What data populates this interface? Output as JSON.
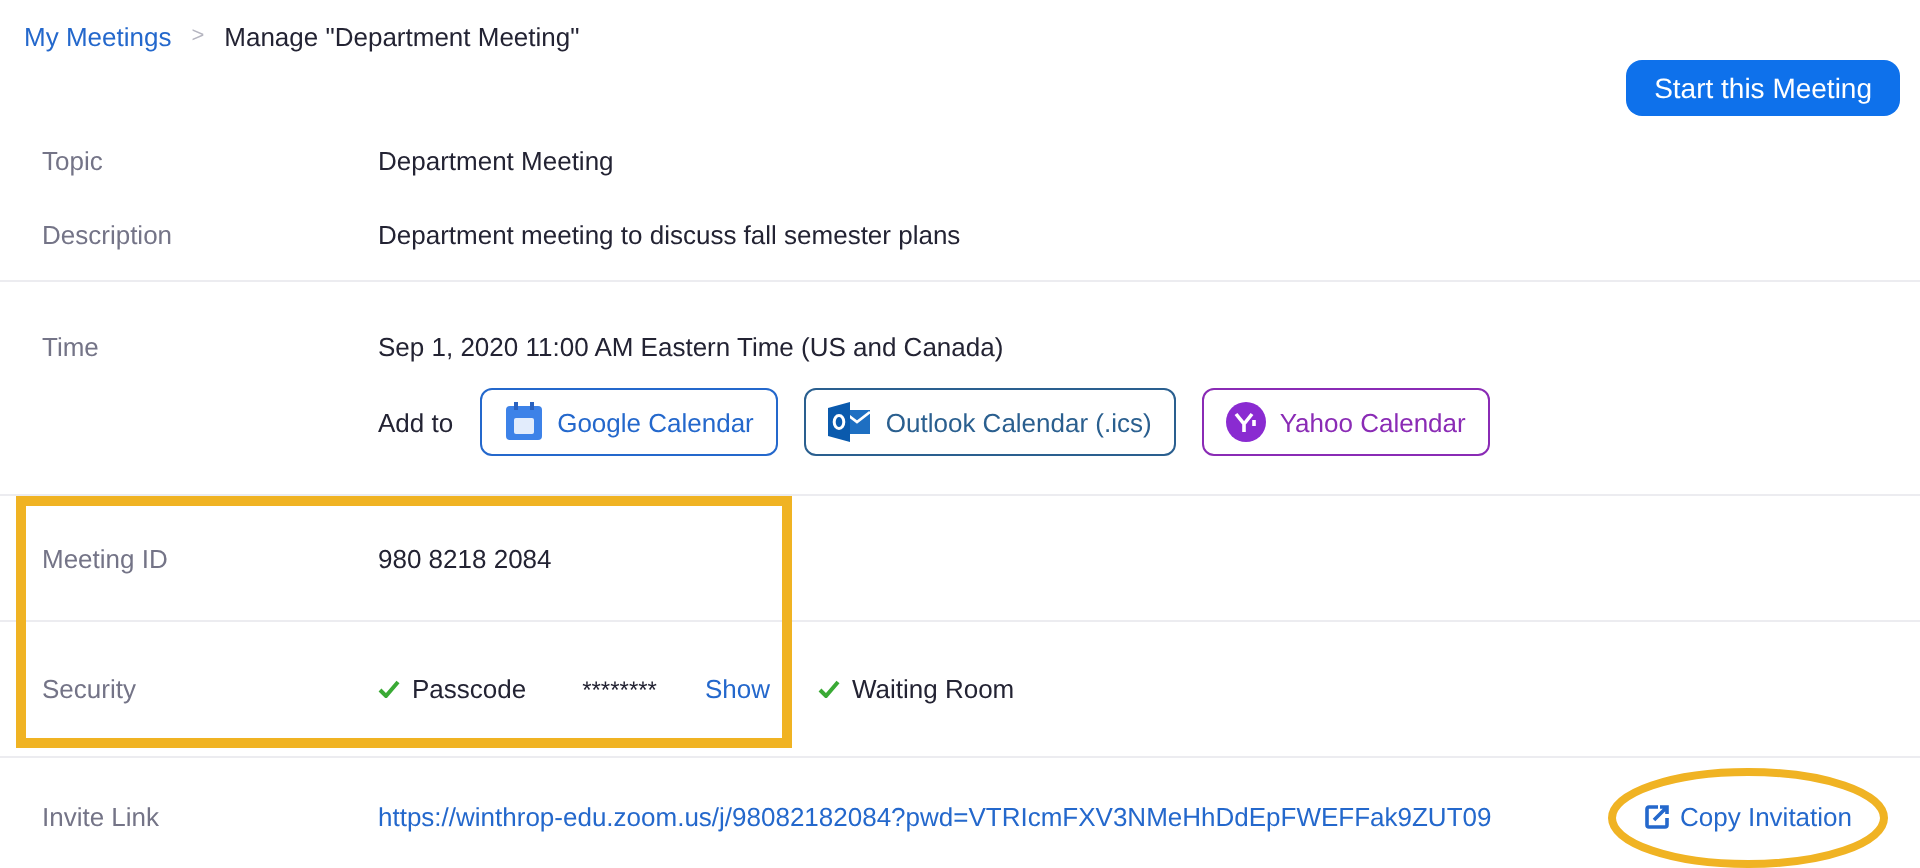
{
  "breadcrumb": [
    {
      "label": "My Meetings",
      "kind": "link"
    },
    {
      "label": "Manage \"Department Meeting\"",
      "kind": "current"
    }
  ],
  "breadcrumb_separator": ">",
  "start_button": "Start this Meeting",
  "sections": [
    {
      "rows": [
        {
          "kind": "text",
          "label": "Topic",
          "value": "Department Meeting"
        },
        {
          "kind": "text",
          "label": "Description",
          "value": "Department meeting to discuss fall semester plans"
        }
      ]
    },
    {
      "rows": [
        {
          "kind": "text",
          "label": "Time",
          "value": "Sep 1, 2020 11:00 AM Eastern Time (US and Canada)"
        },
        {
          "kind": "calendars",
          "prefix": "Add to",
          "items": [
            {
              "name": "Google Calendar",
              "kind": "google"
            },
            {
              "name": "Outlook Calendar (.ics)",
              "kind": "outlook"
            },
            {
              "name": "Yahoo Calendar",
              "kind": "yahoo"
            }
          ]
        }
      ]
    },
    {
      "rows": [
        {
          "kind": "text",
          "label": "Meeting ID",
          "value": "980 8218 2084"
        }
      ]
    },
    {
      "rows": [
        {
          "kind": "security",
          "label": "Security",
          "options": [
            {
              "label": "Passcode",
              "checked": true,
              "secret": "********",
              "action": "Show"
            },
            {
              "label": "Waiting Room",
              "checked": true
            }
          ]
        }
      ]
    },
    {
      "rows": [
        {
          "kind": "invite",
          "label": "Invite Link",
          "value": "https://winthrop-edu.zoom.us/j/98082182084?pwd=VTRIcmFXV3NMeHhDdEpFWEFFak9ZUT09",
          "action": "Copy Invitation"
        }
      ]
    }
  ]
}
